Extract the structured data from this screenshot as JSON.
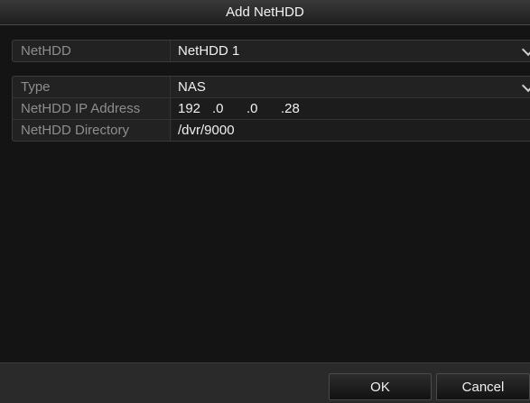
{
  "dialog": {
    "title": "Add NetHDD"
  },
  "netHDD": {
    "label": "NetHDD",
    "value": "NetHDD 1"
  },
  "settings": {
    "type": {
      "label": "Type",
      "value": "NAS"
    },
    "ip": {
      "label": "NetHDD IP Address",
      "octets": [
        "192",
        ".0",
        ".0",
        ".28"
      ]
    },
    "directory": {
      "label": "NetHDD Directory",
      "value": "/dvr/9000"
    }
  },
  "buttons": {
    "ok": "OK",
    "cancel": "Cancel"
  },
  "icons": {
    "dropdown": "chevron-down-icon"
  },
  "colors": {
    "background": "#141414",
    "panel": "#222222",
    "label": "#8e8e8e",
    "text": "#f0f0f0"
  }
}
